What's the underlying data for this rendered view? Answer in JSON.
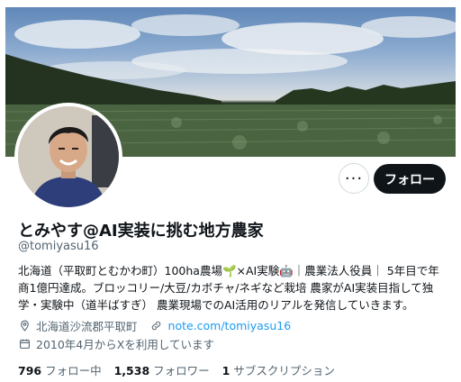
{
  "banner": {
    "kind": "photo-cabbage-field"
  },
  "profile": {
    "display_name": "とみやす@AI実装に挑む地方農家",
    "handle": "@tomiyasu16",
    "bio_lines": [
      "北海道（平取町とむかわ町）100ha農場🌱×AI実験🤖｜農業法人役員｜ 5年目で年",
      "商1億円達成。ブロッコリー/大豆/カボチャ/ネギなど栽培 農家がAI実装目指して独",
      "学・実験中（道半ばすぎ） 農業現場でのAI活用のリアルを発信していきます。"
    ],
    "location": "北海道沙流郡平取町",
    "website": "note.com/tomiyasu16",
    "joined": "2010年4月からXを利用しています"
  },
  "actions": {
    "more_label": "···",
    "follow_label": "フォロー"
  },
  "stats": {
    "following_count": "796",
    "following_label": "フォロー中",
    "followers_count": "1,538",
    "followers_label": "フォロワー",
    "subs_count": "1",
    "subs_label": "サブスクリプション"
  },
  "icons": {
    "location": "location-pin-icon",
    "link": "link-icon",
    "calendar": "calendar-icon"
  },
  "colors": {
    "link": "#1d9bf0",
    "muted": "#536471",
    "text": "#0f1419",
    "follow_bg": "#0f1419"
  }
}
